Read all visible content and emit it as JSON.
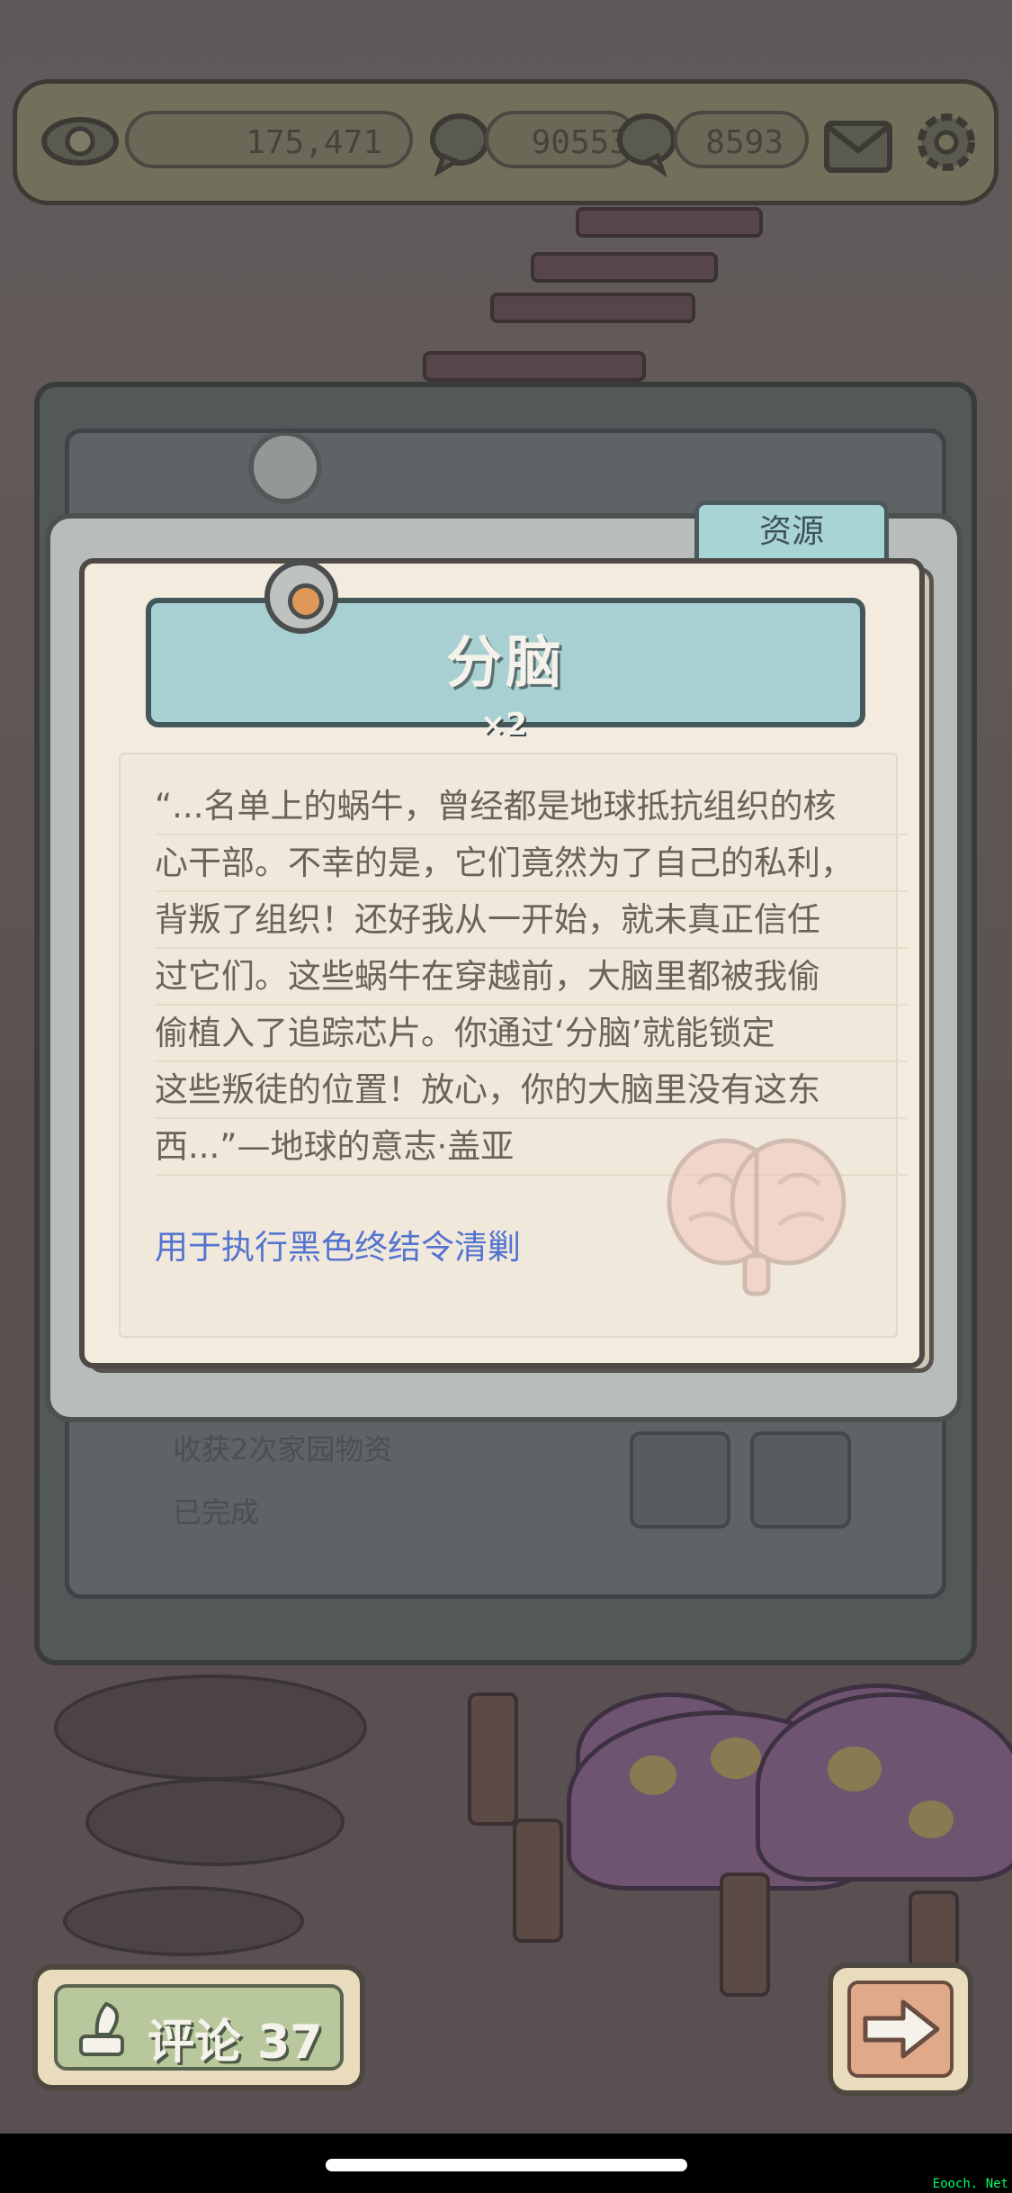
{
  "top_bar": {
    "eye_count": "175,471",
    "chat_count_1": "90553",
    "chat_count_2": "8593",
    "eye_icon": "eye-icon",
    "chat_icon": "speech-bubble-icon",
    "mail_icon": "envelope-icon",
    "settings_icon": "gear-icon"
  },
  "background_panel": {
    "line1": "收获2次家园物资",
    "line2": "已完成"
  },
  "modal": {
    "tab_label": "资源",
    "item_name": "分脑",
    "item_count": "×2",
    "description_lines": [
      "“...名单上的蜗牛，曾经都是地球抵抗组织的核",
      "心干部。不幸的是，它们竟然为了自己的私利，",
      "背叛了组织！还好我从一开始，就未真正信任",
      "过它们。这些蜗牛在穿越前，大脑里都被我偷",
      "偷植入了追踪芯片。你通过‘分脑’就能锁定",
      "这些叛徒的位置！放心，你的大脑里没有这东",
      "西...”—地球的意志·盖亚"
    ],
    "usage_text": "用于执行黑色终结令清剿",
    "item_icon": "brain-icon"
  },
  "buttons": {
    "comment_label": "评论",
    "comment_count": "37",
    "next_icon": "arrow-right-icon"
  },
  "watermark": "Eooch. Net",
  "colors": {
    "accent_teal": "#a8d0d2",
    "link_blue": "#5474d0",
    "paper": "#f3ebde"
  }
}
